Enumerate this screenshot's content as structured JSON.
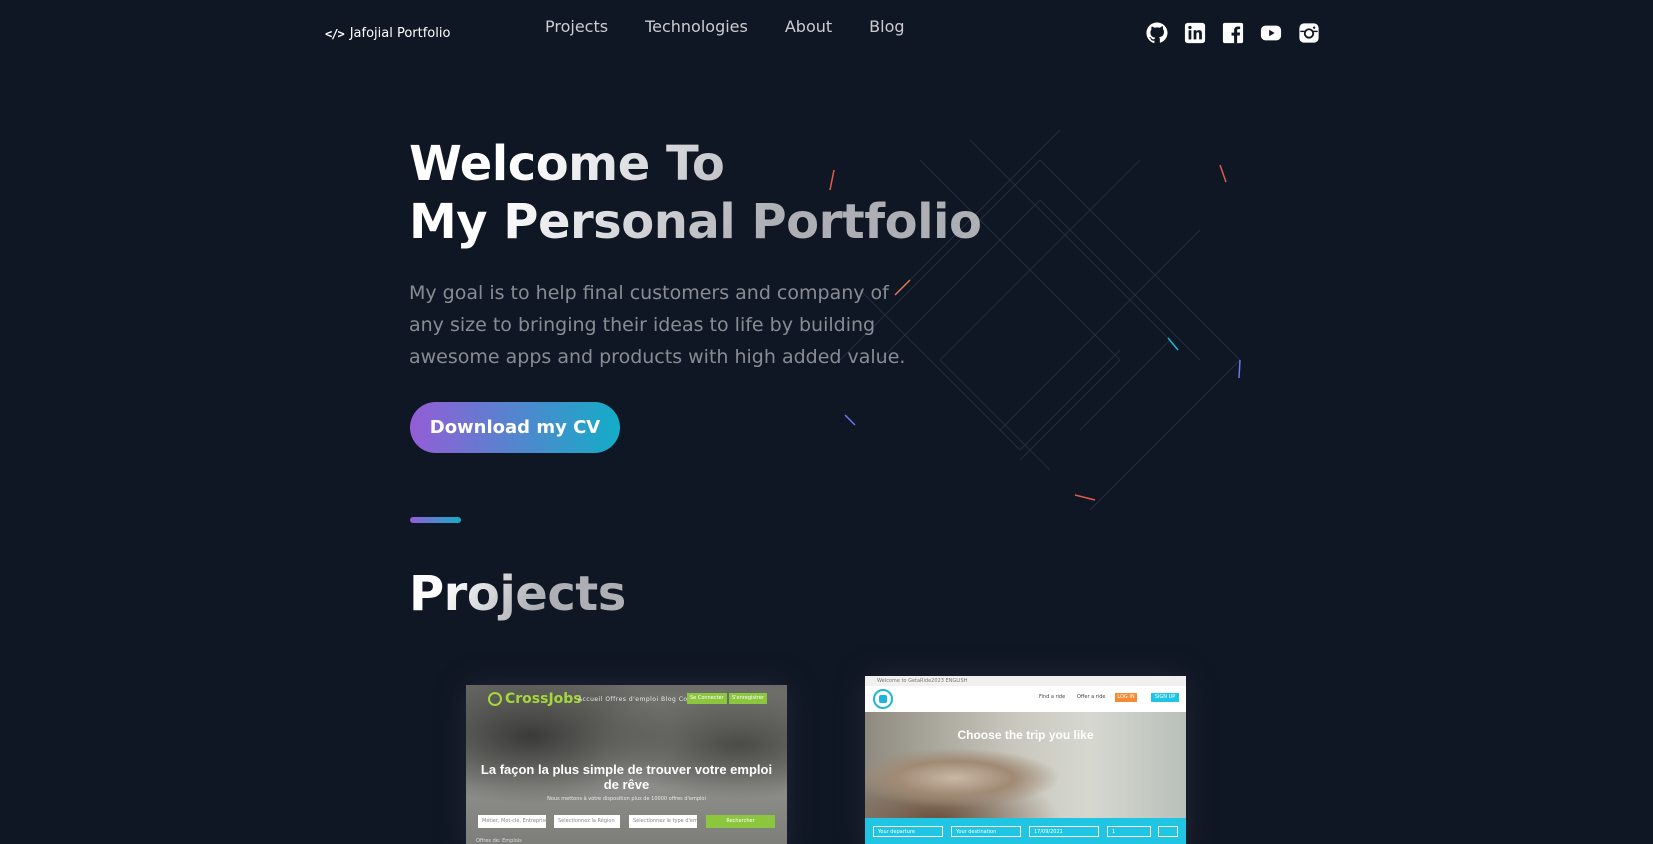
{
  "header": {
    "logo_icon": "</>",
    "logo_text": "Jafojial Portfolio",
    "nav": [
      "Projects",
      "Technologies",
      "About",
      "Blog"
    ],
    "socials": [
      "github-icon",
      "linkedin-icon",
      "facebook-icon",
      "youtube-icon",
      "instagram-icon"
    ]
  },
  "hero": {
    "title_line1": "Welcome To",
    "title_line2": "My Personal Portfolio",
    "text": "My goal is to help final customers and company of any size to bringing their ideas to life by building awesome apps and products with high added value.",
    "cta": "Download my CV"
  },
  "projects": {
    "title": "Projects",
    "cards": [
      {
        "logo": "CrossJobs",
        "nav": "Accueil   Offres d'emploi   Blog   Contact",
        "btn_login": "Se Connecter",
        "btn_register": "S'enregistrer",
        "headline": "La façon la plus simple de trouver votre emploi de rêve",
        "sub": "Nous mettons à votre disposition plus de 10000 offres d'emploi",
        "field_keyword": "Métier, Mot-clé, Entreprise...",
        "field_region": "Sélectionnez la Région",
        "field_type": "Sélectionnez le type d'emploi",
        "search": "Rechercher",
        "tags": "Offres de: Emplois"
      },
      {
        "topbar": "Welcome to GetaRide2023     ENGLISH",
        "find": "Find a ride",
        "offer": "Offer a ride",
        "login": "LOG IN",
        "signup": "SIGN UP",
        "headline": "Choose the trip you like",
        "field_departure": "Your departure",
        "field_destination": "Your destination",
        "field_date": "17/09/2021",
        "field_seats": "1"
      }
    ]
  },
  "colors": {
    "background": "#0f1624",
    "gradient_start": "#945dd6",
    "gradient_end": "#13adc7"
  }
}
